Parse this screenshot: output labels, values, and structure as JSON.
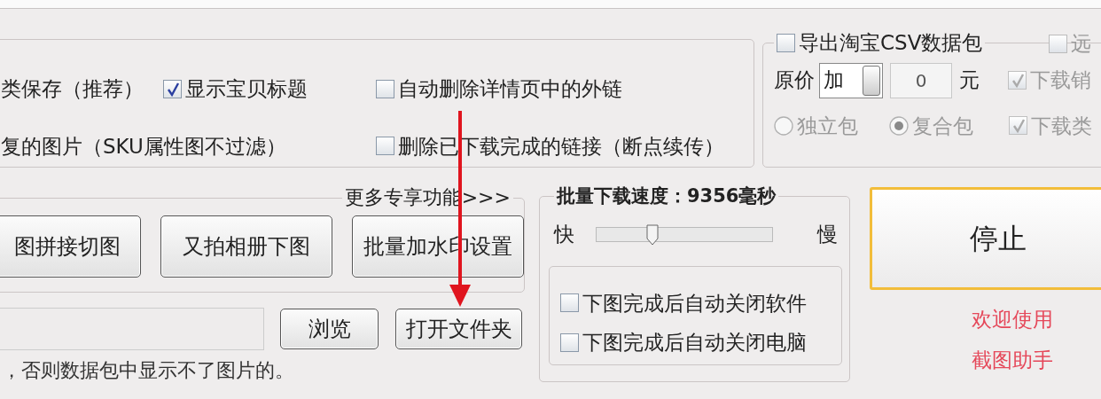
{
  "options_panel": {
    "items": [
      {
        "kind": "text",
        "label": "类保存（推荐）"
      },
      {
        "kind": "checkbox",
        "label": "显示宝贝标题",
        "checked": true
      },
      {
        "kind": "checkbox",
        "label": "自动删除详情页中的外链",
        "checked": false
      },
      {
        "kind": "text",
        "label": "复的图片（SKU属性图不过滤）"
      },
      {
        "kind": "checkbox",
        "label": "删除已下载完成的链接（断点续传）",
        "checked": false
      }
    ]
  },
  "export_panel": {
    "export_checkbox": {
      "label": "导出淘宝CSV数据包",
      "checked": false
    },
    "remote_checkbox": {
      "label": "远",
      "checked": false
    },
    "price": {
      "label": "原价",
      "mode": "加",
      "amount": "0",
      "unit": "元"
    },
    "packages": [
      {
        "label": "独立包",
        "selected": false,
        "disabled": true
      },
      {
        "label": "复合包",
        "selected": true,
        "disabled": true
      }
    ],
    "download_options": [
      {
        "label": "下载销",
        "checked": true,
        "disabled": true
      },
      {
        "label": "下载类",
        "checked": true,
        "disabled": true
      }
    ]
  },
  "more_features": {
    "legend": "更多专享功能>>>",
    "buttons": [
      "图拼接切图",
      "又拍相册下图",
      "批量加水印设置"
    ]
  },
  "folder": {
    "buttons": [
      "浏览",
      "打开文件夹"
    ],
    "note": "，否则数据包中显示不了图片的。"
  },
  "speed": {
    "title": "批量下载速度：9356毫秒",
    "fast_label": "快",
    "slow_label": "慢",
    "level": 0.32,
    "options": [
      {
        "label": "下图完成后自动关闭软件",
        "checked": false
      },
      {
        "label": "下图完成后自动关闭电脑",
        "checked": false
      }
    ]
  },
  "stop_button": "停止",
  "welcome": [
    "欢迎使用",
    "截图助手"
  ]
}
